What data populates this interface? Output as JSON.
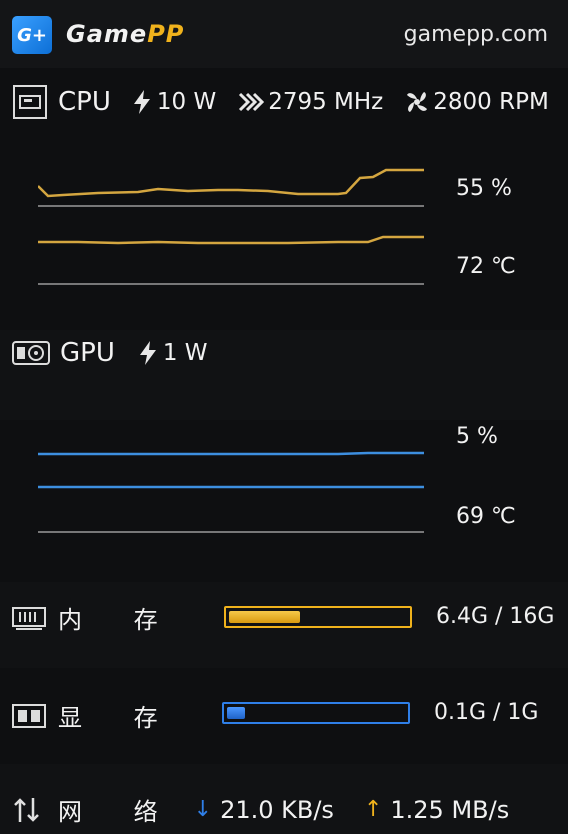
{
  "header": {
    "logo_mark": "G+",
    "app_name_a": "Game",
    "app_name_b": "PP",
    "site": "gamepp.com"
  },
  "cpu": {
    "label": "CPU",
    "power": "10 W",
    "clock": "2795 MHz",
    "fan": "2800 RPM",
    "usage": "55 %",
    "temp": "72 ℃",
    "usage_percent": 55,
    "line_color": "#d4a640"
  },
  "gpu": {
    "label": "GPU",
    "power": "1 W",
    "usage": "5 %",
    "temp": "69 ℃",
    "line_color": "#3d8fe0"
  },
  "memory": {
    "label": "内 存",
    "value": "6.4G / 16G",
    "fraction": 0.4,
    "color": "#f0b21c"
  },
  "vram": {
    "label": "显 存",
    "value": "0.1G / 1G",
    "fraction": 0.1,
    "color": "#2f7fe8"
  },
  "network": {
    "label": "网 络",
    "down": "21.0 KB/s",
    "up": "1.25 MB/s",
    "down_arrow": "↓",
    "up_arrow": "↑"
  },
  "colors": {
    "accent_yellow": "#f0b21c",
    "accent_blue": "#2f7fe8",
    "baseline": "#9a9a9a"
  },
  "icons": [
    "gamepp-logo-icon",
    "cpu-chip-icon",
    "power-bolt-icon",
    "clock-speed-icon",
    "fan-icon",
    "gpu-card-icon",
    "memory-stick-icon",
    "vram-icon",
    "network-arrows-icon"
  ]
}
